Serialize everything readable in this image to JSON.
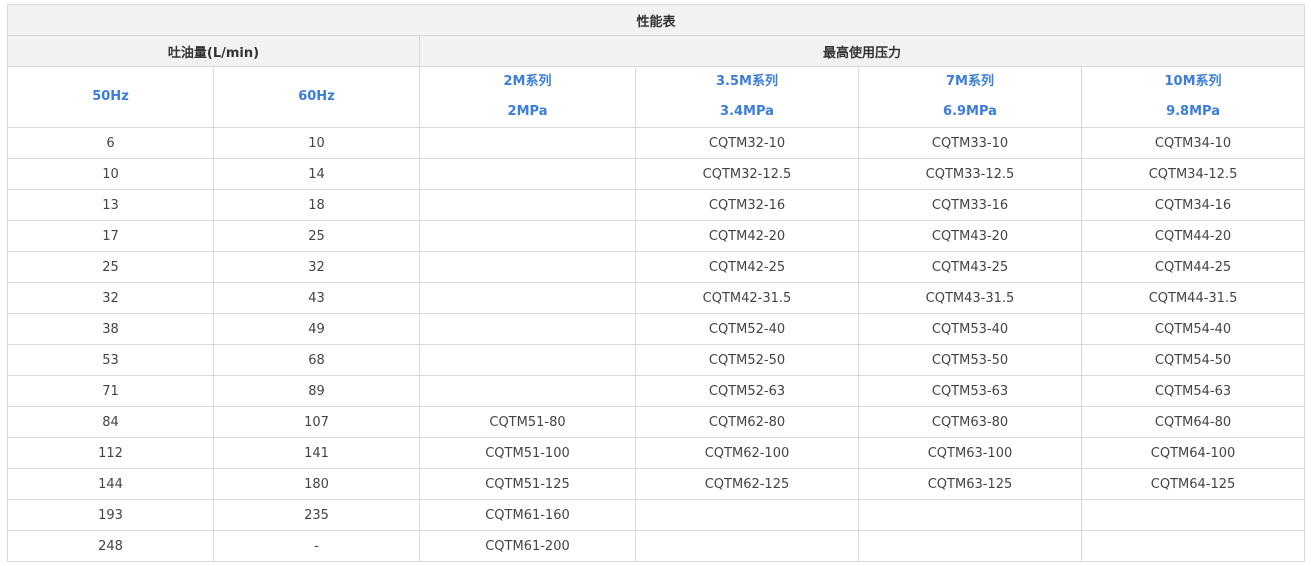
{
  "table": {
    "title": "性能表",
    "group_flow": "吐油量(L/min)",
    "group_pressure": "最高使用压力",
    "headers": {
      "hz50": "50Hz",
      "hz60": "60Hz",
      "s2m": {
        "series": "2M系列",
        "pressure": "2MPa"
      },
      "s35m": {
        "series": "3.5M系列",
        "pressure": "3.4MPa"
      },
      "s7m": {
        "series": "7M系列",
        "pressure": "6.9MPa"
      },
      "s10m": {
        "series": "10M系列",
        "pressure": "9.8MPa"
      }
    },
    "rows": [
      [
        "6",
        "10",
        "",
        "CQTM32-10",
        "CQTM33-10",
        "CQTM34-10"
      ],
      [
        "10",
        "14",
        "",
        "CQTM32-12.5",
        "CQTM33-12.5",
        "CQTM34-12.5"
      ],
      [
        "13",
        "18",
        "",
        "CQTM32-16",
        "CQTM33-16",
        "CQTM34-16"
      ],
      [
        "17",
        "25",
        "",
        "CQTM42-20",
        "CQTM43-20",
        "CQTM44-20"
      ],
      [
        "25",
        "32",
        "",
        "CQTM42-25",
        "CQTM43-25",
        "CQTM44-25"
      ],
      [
        "32",
        "43",
        "",
        "CQTM42-31.5",
        "CQTM43-31.5",
        "CQTM44-31.5"
      ],
      [
        "38",
        "49",
        "",
        "CQTM52-40",
        "CQTM53-40",
        "CQTM54-40"
      ],
      [
        "53",
        "68",
        "",
        "CQTM52-50",
        "CQTM53-50",
        "CQTM54-50"
      ],
      [
        "71",
        "89",
        "",
        "CQTM52-63",
        "CQTM53-63",
        "CQTM54-63"
      ],
      [
        "84",
        "107",
        "CQTM51-80",
        "CQTM62-80",
        "CQTM63-80",
        "CQTM64-80"
      ],
      [
        "112",
        "141",
        "CQTM51-100",
        "CQTM62-100",
        "CQTM63-100",
        "CQTM64-100"
      ],
      [
        "144",
        "180",
        "CQTM51-125",
        "CQTM62-125",
        "CQTM63-125",
        "CQTM64-125"
      ],
      [
        "193",
        "235",
        "CQTM61-160",
        "",
        "",
        ""
      ],
      [
        "248",
        "-",
        "CQTM61-200",
        "",
        "",
        ""
      ]
    ]
  }
}
